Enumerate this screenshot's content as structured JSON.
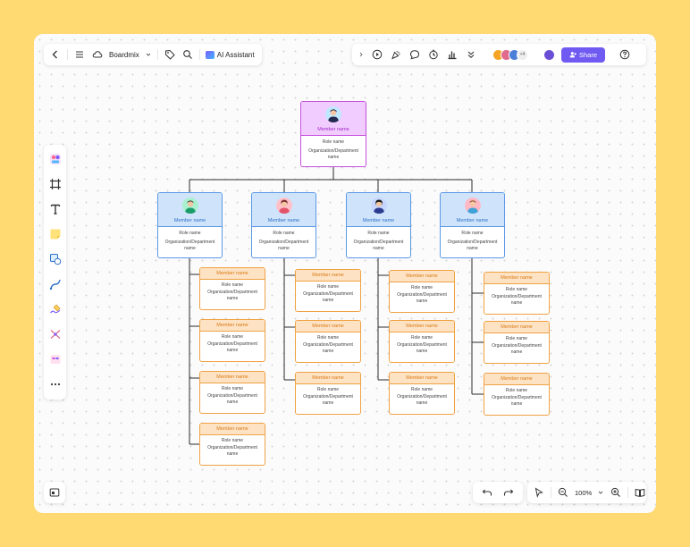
{
  "toolbar": {
    "app_name": "Boardmix",
    "ai_label": "AI Assistant",
    "collaborator_count": "+4",
    "share_label": "Share"
  },
  "zoom": {
    "value": "100%"
  },
  "org_chart": {
    "top": {
      "member": "Member name",
      "role": "Role name",
      "org": "Organization/Department name"
    },
    "branches": [
      {
        "head": {
          "member": "Member name",
          "role": "Role name",
          "org": "Organization/Department name"
        },
        "members": [
          {
            "member": "Member name",
            "role": "Role name",
            "org": "Organization/Department name"
          },
          {
            "member": "Member name",
            "role": "Role name",
            "org": "Organization/Department name"
          },
          {
            "member": "Member name",
            "role": "Role name",
            "org": "Organization/Department name"
          },
          {
            "member": "Member name",
            "role": "Role name",
            "org": "Organization/Department name"
          }
        ]
      },
      {
        "head": {
          "member": "Member name",
          "role": "Role name",
          "org": "Organization/Department name"
        },
        "members": [
          {
            "member": "Member name",
            "role": "Role name",
            "org": "Organization/Department name"
          },
          {
            "member": "Member name",
            "role": "Role name",
            "org": "Organization/Department name"
          },
          {
            "member": "Member name",
            "role": "Role name",
            "org": "Organization/Department name"
          }
        ]
      },
      {
        "head": {
          "member": "Member name",
          "role": "Role name",
          "org": "Organization/Department name"
        },
        "members": [
          {
            "member": "Member name",
            "role": "Role name",
            "org": "Organization/Department name"
          },
          {
            "member": "Member name",
            "role": "Role name",
            "org": "Organization/Department name"
          },
          {
            "member": "Member name",
            "role": "Role name",
            "org": "Organization/Department name"
          }
        ]
      },
      {
        "head": {
          "member": "Member name",
          "role": "Role name",
          "org": "Organization/Department name"
        },
        "members": [
          {
            "member": "Member name",
            "role": "Role name",
            "org": "Organization/Department name"
          },
          {
            "member": "Member name",
            "role": "Role name",
            "org": "Organization/Department name"
          },
          {
            "member": "Member name",
            "role": "Role name",
            "org": "Organization/Department name"
          }
        ]
      }
    ]
  },
  "colors": {
    "background": "#ffd971",
    "accent": "#6f5bf2",
    "top_card": "#c64fdc",
    "head_card": "#5b99e6",
    "member_card": "#f0a243"
  },
  "icons": {
    "top_toolbar_left": [
      "back-icon",
      "menu-icon",
      "cloud-icon",
      "tag-icon",
      "search-icon"
    ],
    "top_toolbar_right": [
      "expand-icon",
      "play-icon",
      "celebrate-icon",
      "comment-icon",
      "timer-icon",
      "chart-icon",
      "more-down-icon",
      "help-icon"
    ],
    "left_tools": [
      "template-icon",
      "frame-icon",
      "text-icon",
      "sticky-note-icon",
      "shape-icon",
      "connector-icon",
      "pen-icon",
      "mindmap-icon",
      "table-icon",
      "more-icon"
    ],
    "bottom": [
      "minimap-icon",
      "undo-icon",
      "redo-icon",
      "select-icon",
      "zoom-out-icon",
      "zoom-in-icon",
      "book-icon"
    ]
  }
}
